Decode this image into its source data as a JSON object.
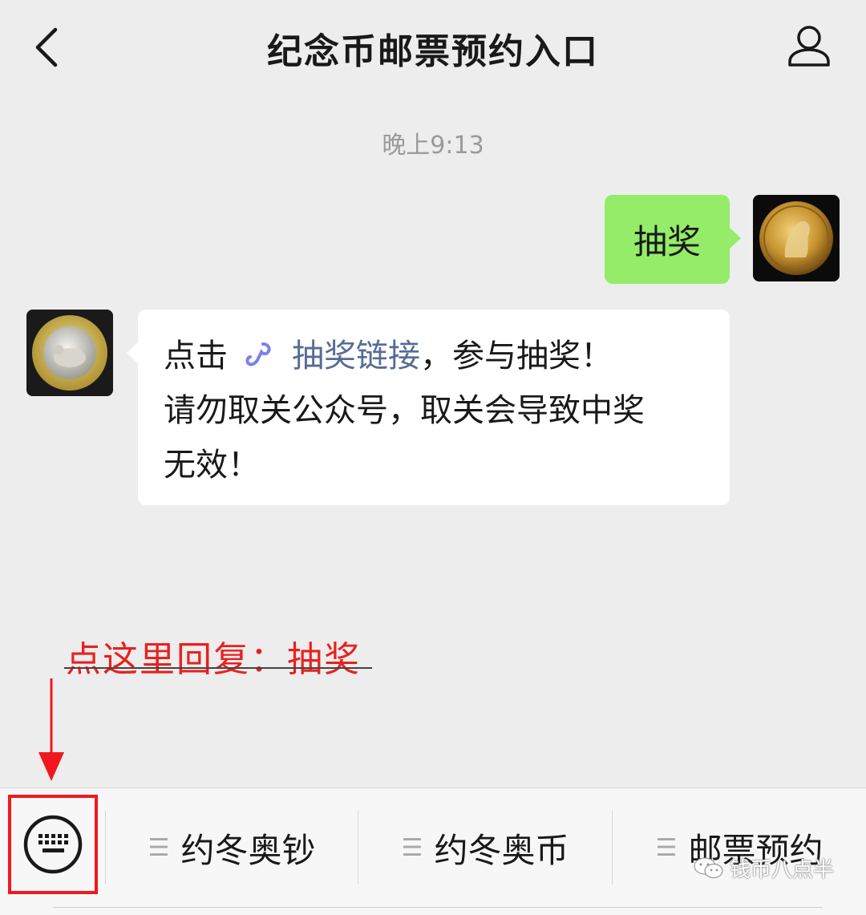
{
  "header": {
    "title": "纪念币邮票预约入口"
  },
  "chat": {
    "timestamp": "晚上9:13",
    "sent_message": "抽奖",
    "reply": {
      "prefix": "点击",
      "link_text": "抽奖链接",
      "after_link": "，参与抽奖！",
      "line2": "请勿取关公众号，取关会导致中奖",
      "line3": "无效！"
    }
  },
  "annotation": {
    "text": "点这里回复：抽奖"
  },
  "menu": {
    "items": [
      {
        "label": "约冬奥钞"
      },
      {
        "label": "约冬奥币"
      },
      {
        "label": "邮票预约"
      }
    ]
  },
  "watermark": {
    "text": "钱币八点半"
  },
  "colors": {
    "sent_bubble": "#95ec69",
    "link": "#576b95",
    "annotation": "#e8211f",
    "highlight_box": "#f0181f"
  }
}
